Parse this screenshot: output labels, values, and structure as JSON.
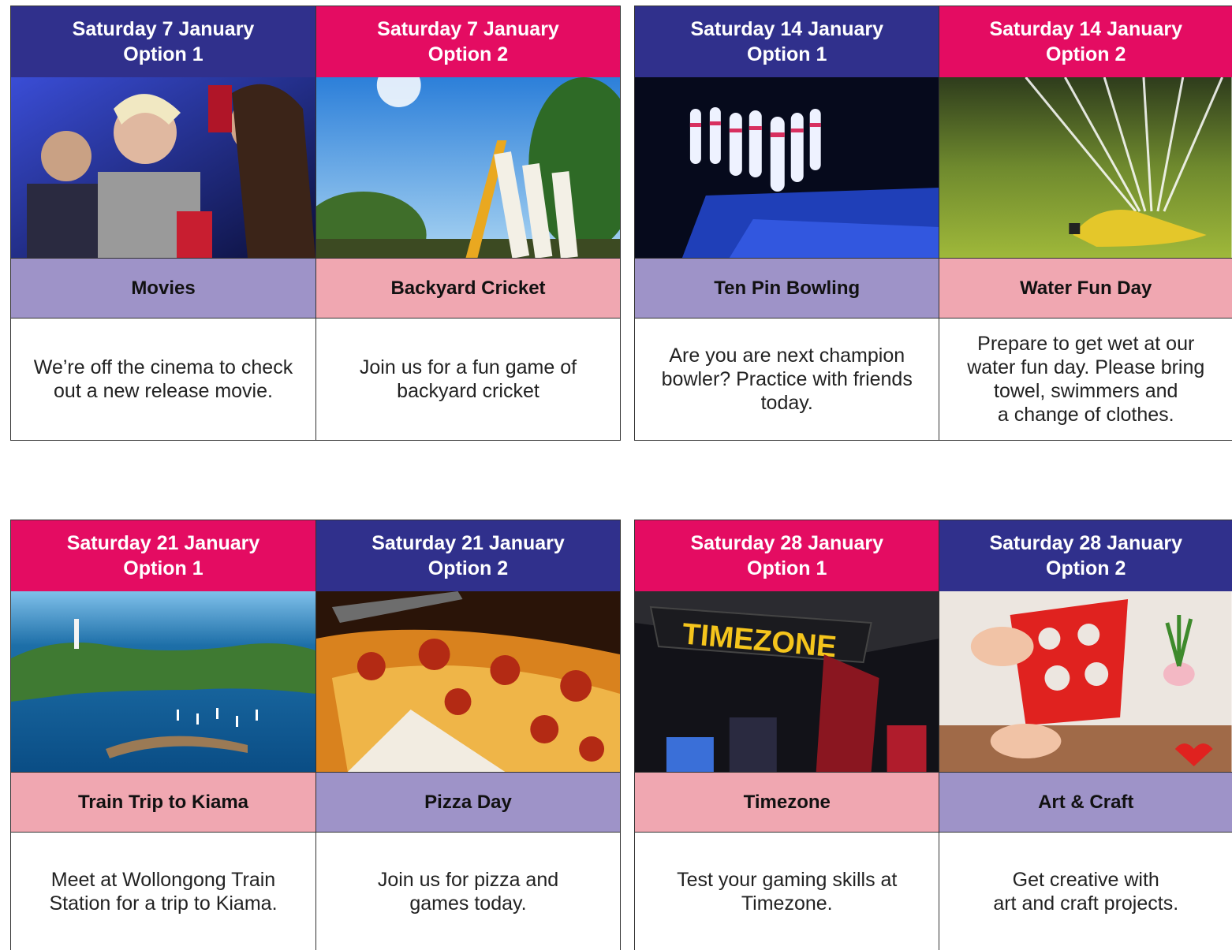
{
  "blocks": [
    {
      "cards": [
        {
          "date": "Saturday 7 January",
          "option": "Option 1",
          "title": "Movies",
          "desc": "We’re off the cinema to check\nout a new release movie.",
          "header_color": "#30308c",
          "title_color": "#9e93c8",
          "image": "cinema-audience-photo"
        },
        {
          "date": "Saturday 7 January",
          "option": "Option 2",
          "title": "Backyard Cricket",
          "desc": "Join us for a fun game of\nbackyard cricket",
          "header_color": "#e40c62",
          "title_color": "#f0a7b1",
          "image": "cricket-stumps-photo"
        }
      ]
    },
    {
      "cards": [
        {
          "date": "Saturday 14 January",
          "option": "Option 1",
          "title": "Ten Pin Bowling",
          "desc": "Are you are next champion\nbowler? Practice with friends\ntoday.",
          "header_color": "#30308c",
          "title_color": "#9e93c8",
          "image": "bowling-pins-photo"
        },
        {
          "date": "Saturday 14 January",
          "option": "Option 2",
          "title": "Water Fun Day",
          "desc": "Prepare to get wet at our\nwater fun day. Please bring\ntowel, swimmers and\na change of clothes.",
          "header_color": "#e40c62",
          "title_color": "#f0a7b1",
          "image": "lawn-sprinkler-photo"
        }
      ]
    },
    {
      "cards": [
        {
          "date": "Saturday 21 January",
          "option": "Option 1",
          "title": "Train Trip to Kiama",
          "desc": "Meet at Wollongong Train\nStation for a trip to Kiama.",
          "header_color": "#e40c62",
          "title_color": "#f0a7b1",
          "image": "harbour-aerial-photo"
        },
        {
          "date": "Saturday 21 January",
          "option": "Option 2",
          "title": "Pizza Day",
          "desc": "Join us for pizza and\ngames today.",
          "header_color": "#30308c",
          "title_color": "#9e93c8",
          "image": "pizza-slice-photo"
        }
      ]
    },
    {
      "cards": [
        {
          "date": "Saturday 28 January",
          "option": "Option 1",
          "title": "Timezone",
          "desc": "Test your gaming skills at\nTimezone.",
          "header_color": "#e40c62",
          "title_color": "#f0a7b1",
          "image": "timezone-arcade-photo",
          "sign_text": "TIMEZONE"
        },
        {
          "date": "Saturday 28 January",
          "option": "Option 2",
          "title": "Art & Craft",
          "desc": "Get creative with\nart and craft projects.",
          "header_color": "#30308c",
          "title_color": "#9e93c8",
          "image": "paper-hearts-craft-photo"
        }
      ]
    }
  ]
}
